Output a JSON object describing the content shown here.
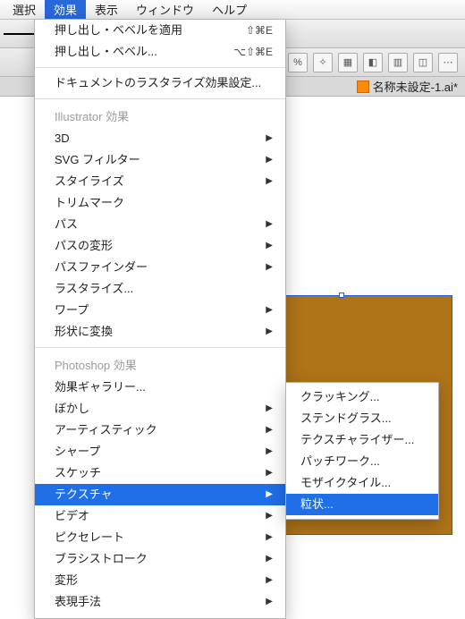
{
  "menubar": {
    "items": [
      {
        "label": "選択"
      },
      {
        "label": "効果"
      },
      {
        "label": "表示"
      },
      {
        "label": "ウィンドウ"
      },
      {
        "label": "ヘルプ"
      }
    ],
    "activeIndex": 1
  },
  "toolbar_right": {
    "percent": "%"
  },
  "doc_tab": {
    "name": "名称未設定-1.ai*"
  },
  "canvas": {
    "rect_color": "#b07418"
  },
  "menu": {
    "top": [
      {
        "label": "押し出し・ベベルを適用",
        "shortcut": "⇧⌘E"
      },
      {
        "label": "押し出し・ベベル...",
        "shortcut": "⌥⇧⌘E"
      }
    ],
    "raster": {
      "label": "ドキュメントのラスタライズ効果設定..."
    },
    "group1_title": "Illustrator 効果",
    "group1": [
      {
        "label": "3D",
        "arrow": true
      },
      {
        "label": "SVG フィルター",
        "arrow": true
      },
      {
        "label": "スタイライズ",
        "arrow": true
      },
      {
        "label": "トリムマーク",
        "arrow": false
      },
      {
        "label": "パス",
        "arrow": true
      },
      {
        "label": "パスの変形",
        "arrow": true
      },
      {
        "label": "パスファインダー",
        "arrow": true
      },
      {
        "label": "ラスタライズ...",
        "arrow": false
      },
      {
        "label": "ワープ",
        "arrow": true
      },
      {
        "label": "形状に変換",
        "arrow": true
      }
    ],
    "group2_title": "Photoshop 効果",
    "group2": [
      {
        "label": "効果ギャラリー...",
        "arrow": false
      },
      {
        "label": "ぼかし",
        "arrow": true
      },
      {
        "label": "アーティスティック",
        "arrow": true
      },
      {
        "label": "シャープ",
        "arrow": true
      },
      {
        "label": "スケッチ",
        "arrow": true
      },
      {
        "label": "テクスチャ",
        "arrow": true,
        "hover": true
      },
      {
        "label": "ビデオ",
        "arrow": true
      },
      {
        "label": "ピクセレート",
        "arrow": true
      },
      {
        "label": "ブラシストローク",
        "arrow": true
      },
      {
        "label": "変形",
        "arrow": true
      },
      {
        "label": "表現手法",
        "arrow": true
      }
    ]
  },
  "submenu": {
    "items": [
      {
        "label": "クラッキング..."
      },
      {
        "label": "ステンドグラス..."
      },
      {
        "label": "テクスチャライザー..."
      },
      {
        "label": "パッチワーク..."
      },
      {
        "label": "モザイクタイル..."
      },
      {
        "label": "粒状...",
        "hover": true
      }
    ]
  }
}
